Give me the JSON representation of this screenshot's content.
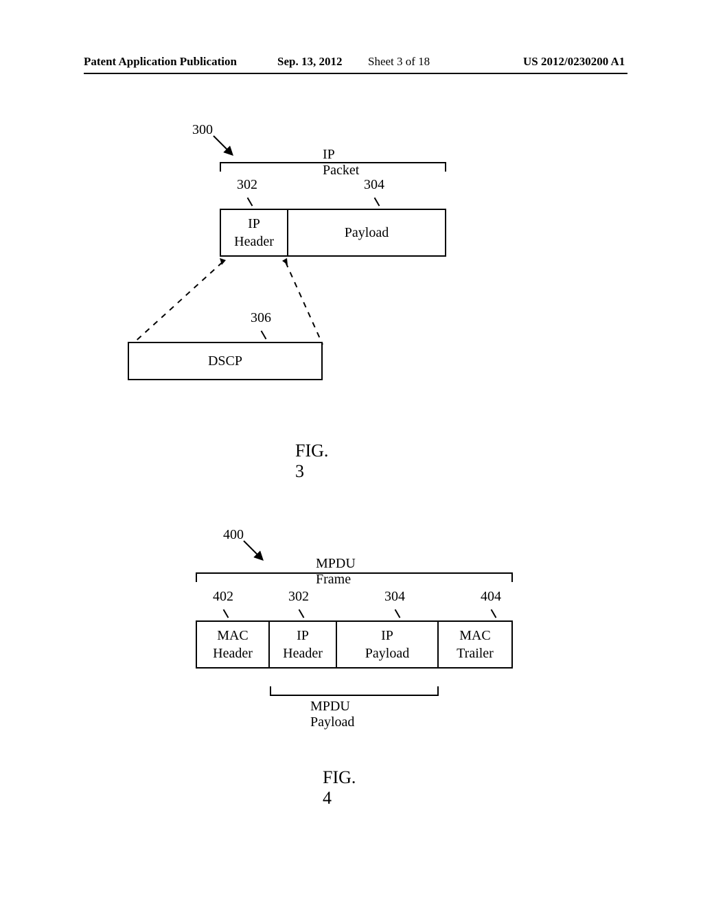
{
  "header": {
    "pub_label": "Patent Application Publication",
    "date": "Sep. 13, 2012",
    "sheet": "Sheet 3 of 18",
    "pubnum": "US 2012/0230200 A1"
  },
  "fig3": {
    "ref_300": "300",
    "title": "IP Packet",
    "ref_302": "302",
    "ref_304": "304",
    "ip_header": "IP\nHeader",
    "payload": "Payload",
    "ref_306": "306",
    "dscp": "DSCP",
    "caption": "FIG. 3"
  },
  "fig4": {
    "ref_400": "400",
    "title": "MPDU Frame",
    "ref_402": "402",
    "ref_302": "302",
    "ref_304": "304",
    "ref_404": "404",
    "mac_header": "MAC\nHeader",
    "ip_header": "IP\nHeader",
    "ip_payload": "IP\nPayload",
    "mac_trailer": "MAC\nTrailer",
    "payload_label": "MPDU Payload",
    "caption": "FIG. 4"
  }
}
